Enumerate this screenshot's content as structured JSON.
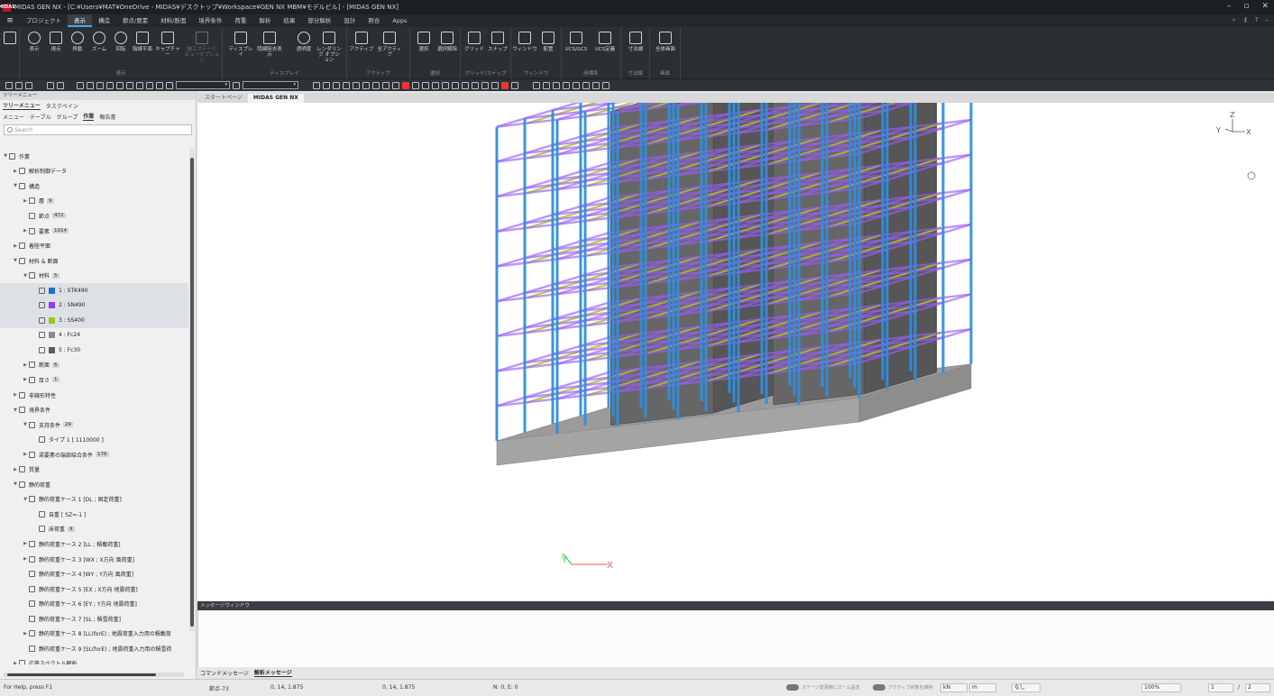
{
  "window": {
    "app_badge": "MIDAS",
    "title": "MIDAS GEN NX - [C:¥Users¥MAT¥OneDrive - MIDAS¥デスクトップ¥Workspace¥GEN NX MBM¥モデルビル] - [MIDAS GEN NX]",
    "controls": [
      "–",
      "▫",
      "✕"
    ]
  },
  "menubar": {
    "items": [
      "プロジェクト",
      "表示",
      "構造",
      "節点/要素",
      "材料/断面",
      "境界条件",
      "荷重",
      "解析",
      "結果",
      "部分解析",
      "設計",
      "照合",
      "Apps"
    ],
    "active": "表示"
  },
  "ribbon": {
    "groups": [
      {
        "label": "表示",
        "buttons": [
          "表示",
          "視点",
          "移動",
          "ズーム",
          "回転",
          "陰線平面",
          "キャプチャー",
          "施工ステージ ビューオプション"
        ]
      },
      {
        "label": "ディスプレイ",
        "buttons": [
          "ディスプレイ",
          "隠線除去表示",
          "透明度",
          "レンダリング オプション"
        ]
      },
      {
        "label": "アクティブ",
        "buttons": [
          "アクティブ",
          "全アクティブ"
        ]
      },
      {
        "label": "選択",
        "buttons": [
          "選択",
          "選択解除"
        ]
      },
      {
        "label": "グリッド/スナップ",
        "buttons": [
          "グリッド",
          "スナップ"
        ]
      },
      {
        "label": "ウィンドウ",
        "buttons": [
          "ウィンドウ",
          "配置"
        ]
      },
      {
        "label": "座標系",
        "buttons": [
          "UCS/GCS",
          "UCS定義"
        ]
      },
      {
        "label": "寸法線",
        "buttons": [
          "寸法線"
        ]
      },
      {
        "label": "画面",
        "buttons": [
          "全体画面"
        ]
      }
    ]
  },
  "left_panel": {
    "title": "ツリーメニュー",
    "subtabs": [
      "ツリーメニュー",
      "タスクペイン"
    ],
    "tabs": [
      "メニュー",
      "テーブル",
      "グループ",
      "作業",
      "報告書"
    ],
    "active_tab": "作業",
    "search_placeholder": "Search",
    "tree": [
      {
        "label": "作業",
        "level": 0,
        "arrow": "▼"
      },
      {
        "label": "解析制御データ",
        "level": 1,
        "arrow": "▶"
      },
      {
        "label": "構造",
        "level": 1,
        "arrow": "▼"
      },
      {
        "label": "層",
        "level": 2,
        "arrow": "▶",
        "badge": "9"
      },
      {
        "label": "節点",
        "level": 2,
        "arrow": "",
        "badge": "472"
      },
      {
        "label": "要素",
        "level": 2,
        "arrow": "▶",
        "badge": "1014"
      },
      {
        "label": "着陸平面",
        "level": 1,
        "arrow": "▶"
      },
      {
        "label": "材料 & 断面",
        "level": 1,
        "arrow": "▼"
      },
      {
        "label": "材料",
        "level": 2,
        "arrow": "▼",
        "badge": "5"
      },
      {
        "label": "1 : STK490",
        "level": 3,
        "arrow": "",
        "swatch": "#1f6fd1",
        "selected": true
      },
      {
        "label": "2 : SN490",
        "level": 3,
        "arrow": "",
        "swatch": "#8a3ff0",
        "selected": true
      },
      {
        "label": "3 : SS400",
        "level": 3,
        "arrow": "",
        "swatch": "#9ec21a",
        "selected": true
      },
      {
        "label": "4 : Fc24",
        "level": 3,
        "arrow": "",
        "swatch": "#8a8a8a"
      },
      {
        "label": "5 : Fc30",
        "level": 3,
        "arrow": "",
        "swatch": "#5b5b5b"
      },
      {
        "label": "断面",
        "level": 2,
        "arrow": "▶",
        "badge": "6"
      },
      {
        "label": "厚さ",
        "level": 2,
        "arrow": "▶",
        "badge": "1"
      },
      {
        "label": "非線形特性",
        "level": 1,
        "arrow": "▶"
      },
      {
        "label": "境界条件",
        "level": 1,
        "arrow": "▼"
      },
      {
        "label": "支持条件",
        "level": 2,
        "arrow": "▼",
        "badge": "24"
      },
      {
        "label": "タイプ 1 [ 1110000 ]",
        "level": 3,
        "arrow": ""
      },
      {
        "label": "梁要素の端部結合条件",
        "level": 2,
        "arrow": "▶",
        "badge": "176"
      },
      {
        "label": "質量",
        "level": 1,
        "arrow": "▶"
      },
      {
        "label": "静的荷重",
        "level": 1,
        "arrow": "▼"
      },
      {
        "label": "静的荷重ケース 1 [DL ; 固定荷重]",
        "level": 2,
        "arrow": "▼"
      },
      {
        "label": "自重 [ SZ=-1 ]",
        "level": 3,
        "arrow": ""
      },
      {
        "label": "床荷重",
        "level": 3,
        "arrow": "",
        "badge": "9"
      },
      {
        "label": "静的荷重ケース 2 [LL ; 積載荷重]",
        "level": 2,
        "arrow": "▶"
      },
      {
        "label": "静的荷重ケース 3 [WX ; X方向 風荷重]",
        "level": 2,
        "arrow": "▶"
      },
      {
        "label": "静的荷重ケース 4 [WY ; Y方向 風荷重]",
        "level": 2,
        "arrow": ""
      },
      {
        "label": "静的荷重ケース 5 [EX ; X方向 地震荷重]",
        "level": 2,
        "arrow": ""
      },
      {
        "label": "静的荷重ケース 6 [EY ; Y方向 地震荷重]",
        "level": 2,
        "arrow": ""
      },
      {
        "label": "静的荷重ケース 7 [SL ; 積雪荷重]",
        "level": 2,
        "arrow": ""
      },
      {
        "label": "静的荷重ケース 8 [LL(forE) ; 地震荷重入力用の積載荷",
        "level": 2,
        "arrow": "▶"
      },
      {
        "label": "静的荷重ケース 9 [SL(forE) ; 地震荷重入力用の積雪荷",
        "level": 2,
        "arrow": ""
      },
      {
        "label": "応答スペクトル解析",
        "level": 1,
        "arrow": "▶"
      }
    ]
  },
  "doc_tabs": [
    "スタートページ",
    "MIDAS GEN NX"
  ],
  "doc_tab_active": "MIDAS GEN NX",
  "axis_triad": {
    "z": "Z",
    "y": "Y",
    "x": "X"
  },
  "message_window": {
    "title": "メッセージウィンドウ",
    "tabs": [
      "コマンドメッセージ",
      "解析メッセージ"
    ],
    "active": "解析メッセージ"
  },
  "statusbar": {
    "help": "For Help, press F1",
    "node": "節点-73",
    "coord1": "0, 14, 1.875",
    "coord2": "0, 14, 1.875",
    "counts": "N: 0, E: 0",
    "toggle1": "ステージ変更時にズーム設定",
    "toggle2": "アクティブ状態を維持",
    "unit_force": "kN",
    "unit_length": "m",
    "filter": "なし",
    "zoom": "100%",
    "page": "1",
    "page_sep": "/",
    "page_total": "2"
  },
  "colors": {
    "column": "#2f8ee0",
    "beam": "#9b5cf2",
    "subbeam": "#a8c236",
    "core": "#5e5e5e",
    "base": "#9b9b9b"
  }
}
